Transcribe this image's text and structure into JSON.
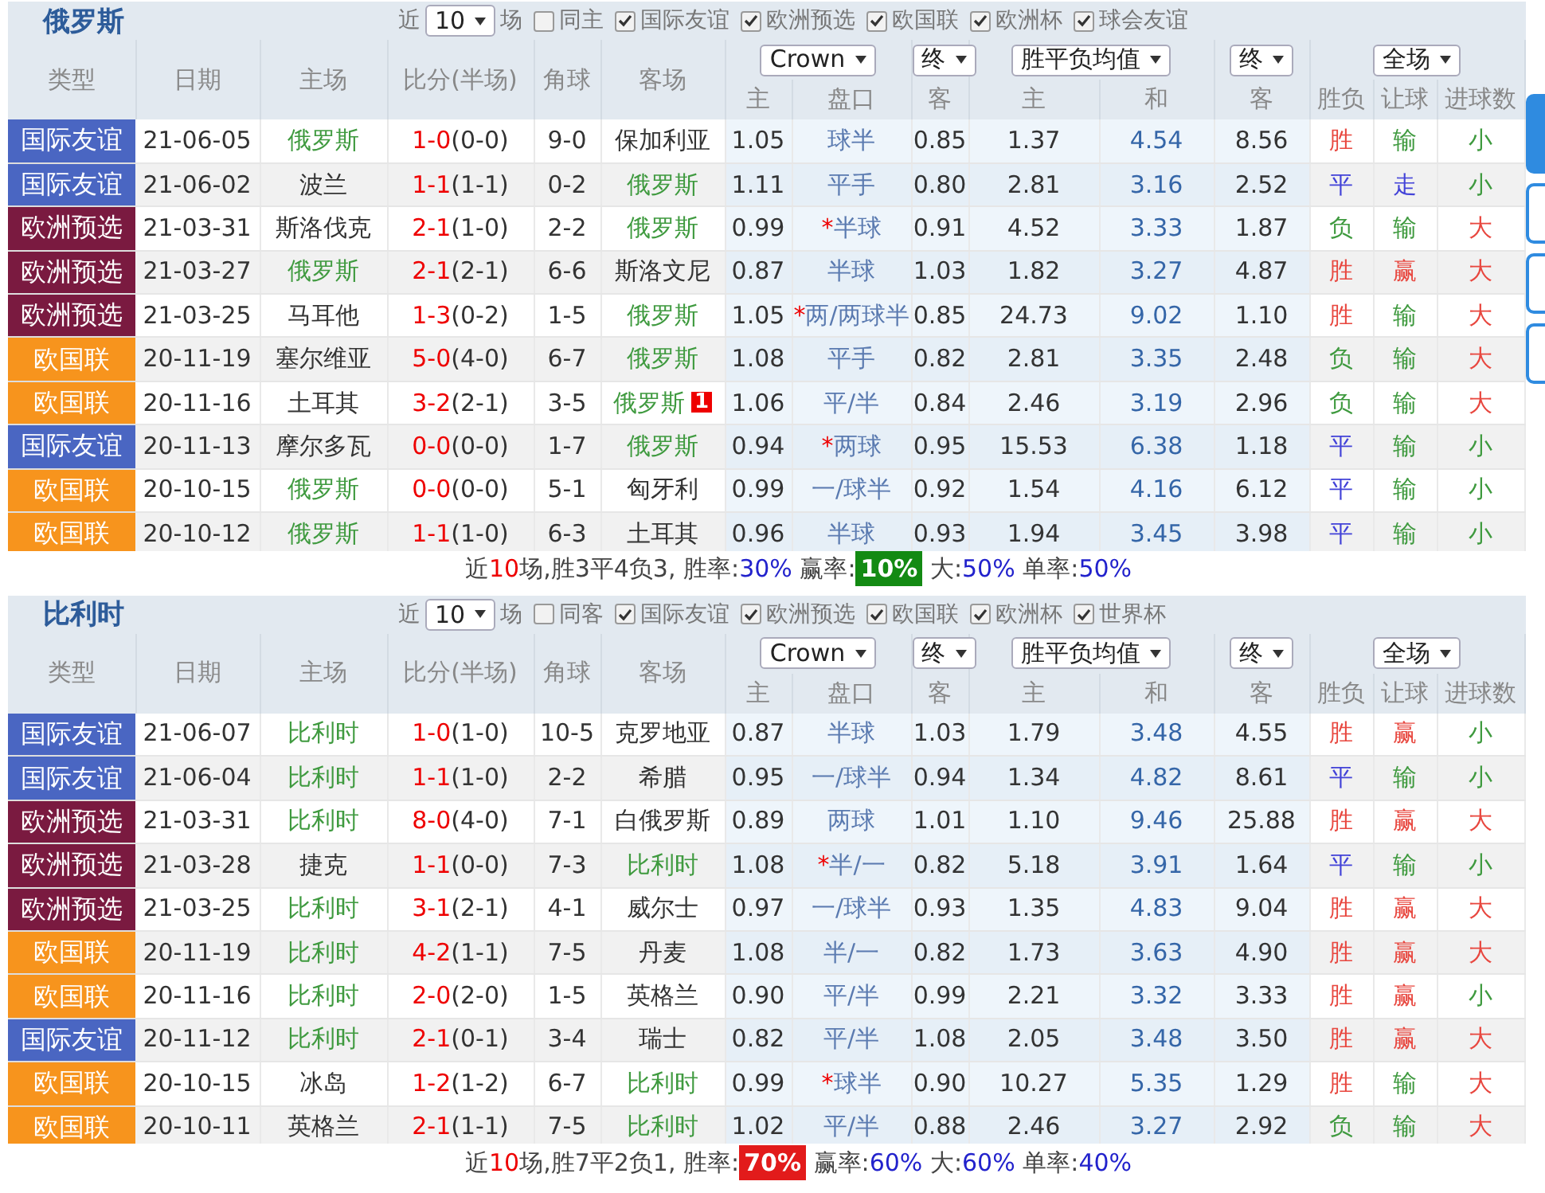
{
  "side_tabs": [
    {
      "selected": true
    },
    {
      "selected": false
    },
    {
      "selected": false
    },
    {
      "selected": false
    }
  ],
  "sections": [
    {
      "team": "俄罗斯",
      "recent_label": "近",
      "count_select": "10",
      "games_label": "场",
      "same_filter": {
        "label": "同主",
        "checked": false
      },
      "filters": [
        {
          "label": "国际友谊",
          "checked": true
        },
        {
          "label": "欧洲预选",
          "checked": true
        },
        {
          "label": "欧国联",
          "checked": true
        },
        {
          "label": "欧洲杯",
          "checked": true
        },
        {
          "label": "球会友谊",
          "checked": true
        }
      ],
      "columns": [
        "类型",
        "日期",
        "主场",
        "比分(半场)",
        "角球",
        "客场"
      ],
      "selects": [
        "Crown",
        "终",
        "胜平负均值",
        "终",
        "全场"
      ],
      "subcolumns": [
        "主",
        "盘口",
        "客",
        "主",
        "和",
        "客",
        "胜负",
        "让球",
        "进球数"
      ],
      "rows": [
        {
          "type": "国际友谊",
          "color": "#4a66c2",
          "date": "21-06-05",
          "home": "俄罗斯",
          "home_focus": true,
          "score": "1-0",
          "half": "(0-0)",
          "corners": "9-0",
          "away": "保加利亚",
          "away_focus": false,
          "odds_home": "1.05",
          "handicap": "球半",
          "odds_away": "0.85",
          "eu_home": "1.37",
          "eu_draw": "4.54",
          "eu_away": "8.56",
          "result": {
            "text": "胜",
            "color": "#e8473f"
          },
          "handicap_result": {
            "text": "输",
            "color": "#3f9a3f"
          },
          "goals": {
            "text": "小",
            "color": "#3f9a3f"
          }
        },
        {
          "type": "国际友谊",
          "color": "#4a66c2",
          "date": "21-06-02",
          "home": "波兰",
          "home_focus": false,
          "score": "1-1",
          "half": "(1-1)",
          "corners": "0-2",
          "away": "俄罗斯",
          "away_focus": true,
          "odds_home": "1.11",
          "handicap": "平手",
          "odds_away": "0.80",
          "eu_home": "2.81",
          "eu_draw": "3.16",
          "eu_away": "2.52",
          "result": {
            "text": "平",
            "color": "#4343d8"
          },
          "handicap_result": {
            "text": "走",
            "color": "#4343d8"
          },
          "goals": {
            "text": "小",
            "color": "#3f9a3f"
          }
        },
        {
          "type": "欧洲预选",
          "color": "#7a1a40",
          "date": "21-03-31",
          "home": "斯洛伐克",
          "home_focus": false,
          "score": "2-1",
          "half": "(1-0)",
          "corners": "2-2",
          "away": "俄罗斯",
          "away_focus": true,
          "odds_home": "0.99",
          "mark": "*",
          "handicap": "半球",
          "odds_away": "0.91",
          "eu_home": "4.52",
          "eu_draw": "3.33",
          "eu_away": "1.87",
          "result": {
            "text": "负",
            "color": "#3f9a3f"
          },
          "handicap_result": {
            "text": "输",
            "color": "#3f9a3f"
          },
          "goals": {
            "text": "大",
            "color": "#e8473f"
          }
        },
        {
          "type": "欧洲预选",
          "color": "#7a1a40",
          "date": "21-03-27",
          "home": "俄罗斯",
          "home_focus": true,
          "score": "2-1",
          "half": "(2-1)",
          "corners": "6-6",
          "away": "斯洛文尼",
          "away_focus": false,
          "odds_home": "0.87",
          "handicap": "半球",
          "odds_away": "1.03",
          "eu_home": "1.82",
          "eu_draw": "3.27",
          "eu_away": "4.87",
          "result": {
            "text": "胜",
            "color": "#e8473f"
          },
          "handicap_result": {
            "text": "赢",
            "color": "#e8473f"
          },
          "goals": {
            "text": "大",
            "color": "#e8473f"
          }
        },
        {
          "type": "欧洲预选",
          "color": "#7a1a40",
          "date": "21-03-25",
          "home": "马耳他",
          "home_focus": false,
          "score": "1-3",
          "half": "(0-2)",
          "corners": "1-5",
          "away": "俄罗斯",
          "away_focus": true,
          "odds_home": "1.05",
          "mark": "*",
          "handicap": "两/两球半",
          "odds_away": "0.85",
          "eu_home": "24.73",
          "eu_draw": "9.02",
          "eu_away": "1.10",
          "result": {
            "text": "胜",
            "color": "#e8473f"
          },
          "handicap_result": {
            "text": "输",
            "color": "#3f9a3f"
          },
          "goals": {
            "text": "大",
            "color": "#e8473f"
          }
        },
        {
          "type": "欧国联",
          "color": "#f7941d",
          "date": "20-11-19",
          "home": "塞尔维亚",
          "home_focus": false,
          "score": "5-0",
          "half": "(4-0)",
          "corners": "6-7",
          "away": "俄罗斯",
          "away_focus": true,
          "odds_home": "1.08",
          "handicap": "平手",
          "odds_away": "0.82",
          "eu_home": "2.81",
          "eu_draw": "3.35",
          "eu_away": "2.48",
          "result": {
            "text": "负",
            "color": "#3f9a3f"
          },
          "handicap_result": {
            "text": "输",
            "color": "#3f9a3f"
          },
          "goals": {
            "text": "大",
            "color": "#e8473f"
          }
        },
        {
          "type": "欧国联",
          "color": "#f7941d",
          "date": "20-11-16",
          "home": "土耳其",
          "home_focus": false,
          "score": "3-2",
          "half": "(2-1)",
          "corners": "3-5",
          "away": "俄罗斯",
          "away_focus": true,
          "away_card": "1",
          "odds_home": "1.06",
          "handicap": "平/半",
          "odds_away": "0.84",
          "eu_home": "2.46",
          "eu_draw": "3.19",
          "eu_away": "2.96",
          "result": {
            "text": "负",
            "color": "#3f9a3f"
          },
          "handicap_result": {
            "text": "输",
            "color": "#3f9a3f"
          },
          "goals": {
            "text": "大",
            "color": "#e8473f"
          }
        },
        {
          "type": "国际友谊",
          "color": "#4a66c2",
          "date": "20-11-13",
          "home": "摩尔多瓦",
          "home_focus": false,
          "score": "0-0",
          "half": "(0-0)",
          "corners": "1-7",
          "away": "俄罗斯",
          "away_focus": true,
          "odds_home": "0.94",
          "mark": "*",
          "handicap": "两球",
          "odds_away": "0.95",
          "eu_home": "15.53",
          "eu_draw": "6.38",
          "eu_away": "1.18",
          "result": {
            "text": "平",
            "color": "#4343d8"
          },
          "handicap_result": {
            "text": "输",
            "color": "#3f9a3f"
          },
          "goals": {
            "text": "小",
            "color": "#3f9a3f"
          }
        },
        {
          "type": "欧国联",
          "color": "#f7941d",
          "date": "20-10-15",
          "home": "俄罗斯",
          "home_focus": true,
          "score": "0-0",
          "half": "(0-0)",
          "corners": "5-1",
          "away": "匈牙利",
          "away_focus": false,
          "odds_home": "0.99",
          "handicap": "一/球半",
          "odds_away": "0.92",
          "eu_home": "1.54",
          "eu_draw": "4.16",
          "eu_away": "6.12",
          "result": {
            "text": "平",
            "color": "#4343d8"
          },
          "handicap_result": {
            "text": "输",
            "color": "#3f9a3f"
          },
          "goals": {
            "text": "小",
            "color": "#3f9a3f"
          }
        },
        {
          "type": "欧国联",
          "color": "#f7941d",
          "date": "20-10-12",
          "home": "俄罗斯",
          "home_focus": true,
          "score": "1-1",
          "half": "(1-0)",
          "corners": "6-3",
          "away": "土耳其",
          "away_focus": false,
          "odds_home": "0.96",
          "handicap": "半球",
          "odds_away": "0.93",
          "eu_home": "1.94",
          "eu_draw": "3.45",
          "eu_away": "3.98",
          "result": {
            "text": "平",
            "color": "#4343d8"
          },
          "handicap_result": {
            "text": "输",
            "color": "#3f9a3f"
          },
          "goals": {
            "text": "小",
            "color": "#3f9a3f"
          }
        }
      ],
      "summary": {
        "prefix": "近",
        "count": "10",
        "record": "场,胜3平4负3, ",
        "stats": [
          {
            "label": "胜率:",
            "value": "30%"
          },
          {
            "label": "赢率:",
            "value": "10%",
            "color": "#138a13"
          },
          {
            "label": "大:",
            "value": "50%"
          },
          {
            "label": "单率:",
            "value": "50%"
          }
        ]
      }
    },
    {
      "team": "比利时",
      "recent_label": "近",
      "count_select": "10",
      "games_label": "场",
      "same_filter": {
        "label": "同客",
        "checked": false
      },
      "filters": [
        {
          "label": "国际友谊",
          "checked": true
        },
        {
          "label": "欧洲预选",
          "checked": true
        },
        {
          "label": "欧国联",
          "checked": true
        },
        {
          "label": "欧洲杯",
          "checked": true
        },
        {
          "label": "世界杯",
          "checked": true
        }
      ],
      "columns": [
        "类型",
        "日期",
        "主场",
        "比分(半场)",
        "角球",
        "客场"
      ],
      "selects": [
        "Crown",
        "终",
        "胜平负均值",
        "终",
        "全场"
      ],
      "subcolumns": [
        "主",
        "盘口",
        "客",
        "主",
        "和",
        "客",
        "胜负",
        "让球",
        "进球数"
      ],
      "rows": [
        {
          "type": "国际友谊",
          "color": "#4a66c2",
          "date": "21-06-07",
          "home": "比利时",
          "home_focus": true,
          "score": "1-0",
          "half": "(1-0)",
          "corners": "10-5",
          "away": "克罗地亚",
          "away_focus": false,
          "odds_home": "0.87",
          "handicap": "半球",
          "odds_away": "1.03",
          "eu_home": "1.79",
          "eu_draw": "3.48",
          "eu_away": "4.55",
          "result": {
            "text": "胜",
            "color": "#e8473f"
          },
          "handicap_result": {
            "text": "赢",
            "color": "#e8473f"
          },
          "goals": {
            "text": "小",
            "color": "#3f9a3f"
          }
        },
        {
          "type": "国际友谊",
          "color": "#4a66c2",
          "date": "21-06-04",
          "home": "比利时",
          "home_focus": true,
          "score": "1-1",
          "half": "(1-0)",
          "corners": "2-2",
          "away": "希腊",
          "away_focus": false,
          "odds_home": "0.95",
          "handicap": "一/球半",
          "odds_away": "0.94",
          "eu_home": "1.34",
          "eu_draw": "4.82",
          "eu_away": "8.61",
          "result": {
            "text": "平",
            "color": "#4343d8"
          },
          "handicap_result": {
            "text": "输",
            "color": "#3f9a3f"
          },
          "goals": {
            "text": "小",
            "color": "#3f9a3f"
          }
        },
        {
          "type": "欧洲预选",
          "color": "#7a1a40",
          "date": "21-03-31",
          "home": "比利时",
          "home_focus": true,
          "score": "8-0",
          "half": "(4-0)",
          "corners": "7-1",
          "away": "白俄罗斯",
          "away_focus": false,
          "odds_home": "0.89",
          "handicap": "两球",
          "odds_away": "1.01",
          "eu_home": "1.10",
          "eu_draw": "9.46",
          "eu_away": "25.88",
          "result": {
            "text": "胜",
            "color": "#e8473f"
          },
          "handicap_result": {
            "text": "赢",
            "color": "#e8473f"
          },
          "goals": {
            "text": "大",
            "color": "#e8473f"
          }
        },
        {
          "type": "欧洲预选",
          "color": "#7a1a40",
          "date": "21-03-28",
          "home": "捷克",
          "home_focus": false,
          "score": "1-1",
          "half": "(0-0)",
          "corners": "7-3",
          "away": "比利时",
          "away_focus": true,
          "odds_home": "1.08",
          "mark": "*",
          "handicap": "半/一",
          "odds_away": "0.82",
          "eu_home": "5.18",
          "eu_draw": "3.91",
          "eu_away": "1.64",
          "result": {
            "text": "平",
            "color": "#4343d8"
          },
          "handicap_result": {
            "text": "输",
            "color": "#3f9a3f"
          },
          "goals": {
            "text": "小",
            "color": "#3f9a3f"
          }
        },
        {
          "type": "欧洲预选",
          "color": "#7a1a40",
          "date": "21-03-25",
          "home": "比利时",
          "home_focus": true,
          "score": "3-1",
          "half": "(2-1)",
          "corners": "4-1",
          "away": "威尔士",
          "away_focus": false,
          "odds_home": "0.97",
          "handicap": "一/球半",
          "odds_away": "0.93",
          "eu_home": "1.35",
          "eu_draw": "4.83",
          "eu_away": "9.04",
          "result": {
            "text": "胜",
            "color": "#e8473f"
          },
          "handicap_result": {
            "text": "赢",
            "color": "#e8473f"
          },
          "goals": {
            "text": "大",
            "color": "#e8473f"
          }
        },
        {
          "type": "欧国联",
          "color": "#f7941d",
          "date": "20-11-19",
          "home": "比利时",
          "home_focus": true,
          "score": "4-2",
          "half": "(1-1)",
          "corners": "7-5",
          "away": "丹麦",
          "away_focus": false,
          "odds_home": "1.08",
          "handicap": "半/一",
          "odds_away": "0.82",
          "eu_home": "1.73",
          "eu_draw": "3.63",
          "eu_away": "4.90",
          "result": {
            "text": "胜",
            "color": "#e8473f"
          },
          "handicap_result": {
            "text": "赢",
            "color": "#e8473f"
          },
          "goals": {
            "text": "大",
            "color": "#e8473f"
          }
        },
        {
          "type": "欧国联",
          "color": "#f7941d",
          "date": "20-11-16",
          "home": "比利时",
          "home_focus": true,
          "score": "2-0",
          "half": "(2-0)",
          "corners": "1-5",
          "away": "英格兰",
          "away_focus": false,
          "odds_home": "0.90",
          "handicap": "平/半",
          "odds_away": "0.99",
          "eu_home": "2.21",
          "eu_draw": "3.32",
          "eu_away": "3.33",
          "result": {
            "text": "胜",
            "color": "#e8473f"
          },
          "handicap_result": {
            "text": "赢",
            "color": "#e8473f"
          },
          "goals": {
            "text": "小",
            "color": "#3f9a3f"
          }
        },
        {
          "type": "国际友谊",
          "color": "#4a66c2",
          "date": "20-11-12",
          "home": "比利时",
          "home_focus": true,
          "score": "2-1",
          "half": "(0-1)",
          "corners": "3-4",
          "away": "瑞士",
          "away_focus": false,
          "odds_home": "0.82",
          "handicap": "平/半",
          "odds_away": "1.08",
          "eu_home": "2.05",
          "eu_draw": "3.48",
          "eu_away": "3.50",
          "result": {
            "text": "胜",
            "color": "#e8473f"
          },
          "handicap_result": {
            "text": "赢",
            "color": "#e8473f"
          },
          "goals": {
            "text": "大",
            "color": "#e8473f"
          }
        },
        {
          "type": "欧国联",
          "color": "#f7941d",
          "date": "20-10-15",
          "home": "冰岛",
          "home_focus": false,
          "score": "1-2",
          "half": "(1-2)",
          "corners": "6-7",
          "away": "比利时",
          "away_focus": true,
          "odds_home": "0.99",
          "mark": "*",
          "handicap": "球半",
          "odds_away": "0.90",
          "eu_home": "10.27",
          "eu_draw": "5.35",
          "eu_away": "1.29",
          "result": {
            "text": "胜",
            "color": "#e8473f"
          },
          "handicap_result": {
            "text": "输",
            "color": "#3f9a3f"
          },
          "goals": {
            "text": "大",
            "color": "#e8473f"
          }
        },
        {
          "type": "欧国联",
          "color": "#f7941d",
          "date": "20-10-11",
          "home": "英格兰",
          "home_focus": false,
          "score": "2-1",
          "half": "(1-1)",
          "corners": "7-5",
          "away": "比利时",
          "away_focus": true,
          "odds_home": "1.02",
          "handicap": "平/半",
          "odds_away": "0.88",
          "eu_home": "2.46",
          "eu_draw": "3.27",
          "eu_away": "2.92",
          "result": {
            "text": "负",
            "color": "#3f9a3f"
          },
          "handicap_result": {
            "text": "输",
            "color": "#3f9a3f"
          },
          "goals": {
            "text": "大",
            "color": "#e8473f"
          }
        }
      ],
      "summary": {
        "prefix": "近",
        "count": "10",
        "record": "场,胜7平2负1, ",
        "stats": [
          {
            "label": "胜率:",
            "value": "70%",
            "color": "#e21b1b"
          },
          {
            "label": "赢率:",
            "value": "60%"
          },
          {
            "label": "大:",
            "value": "60%"
          },
          {
            "label": "单率:",
            "value": "40%"
          }
        ]
      }
    }
  ]
}
